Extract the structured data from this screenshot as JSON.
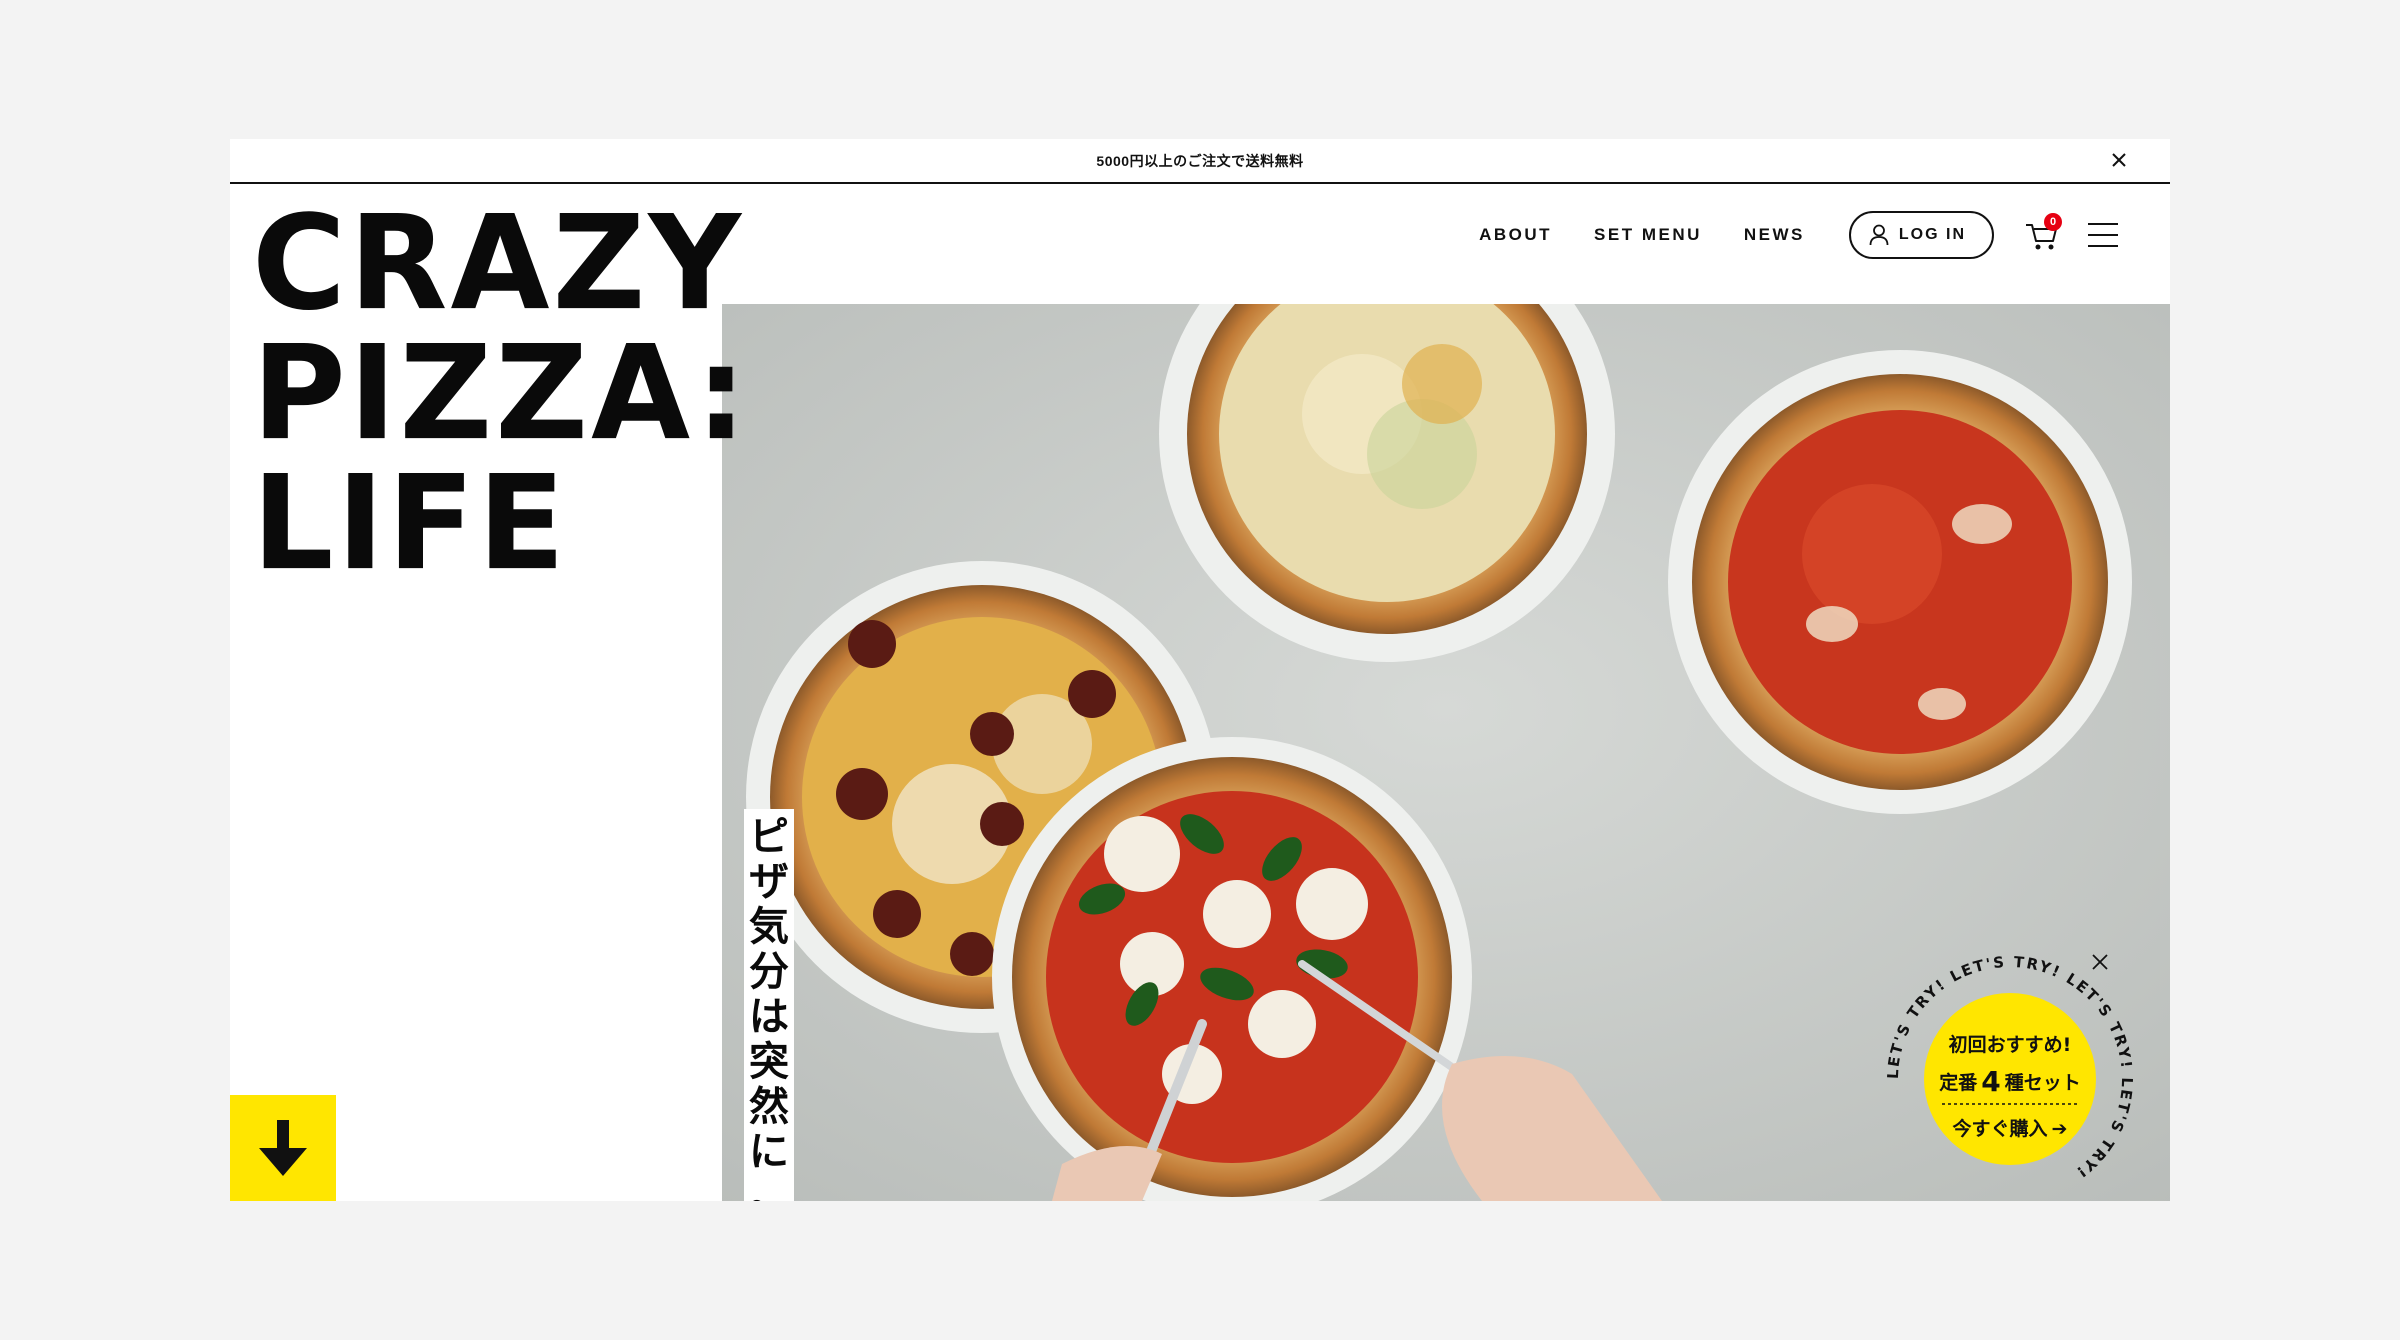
{
  "announcement": {
    "text": "5000円以上のご注文で送料無料"
  },
  "logo": {
    "lines": [
      "CRAZY",
      "PIZZA:",
      "LIFE"
    ]
  },
  "nav": {
    "items": [
      {
        "label": "ABOUT"
      },
      {
        "label": "SET MENU"
      },
      {
        "label": "NEWS"
      }
    ],
    "login_label": "LOG IN",
    "cart_count": "0"
  },
  "tagline": {
    "chars": [
      "ピ",
      "ザ",
      "気",
      "分",
      "は",
      "突",
      "然",
      "に",
      "。"
    ]
  },
  "promo": {
    "ring_text": "LET'S TRY! LET'S TRY! LET'S TRY! LET'S TRY! ",
    "line1": "初回おすすめ!",
    "line2_pre": "定番",
    "line2_num": "4",
    "line2_post": "種セット",
    "cta": "今すぐ購入",
    "cta_arrow": "➔"
  },
  "colors": {
    "accent": "#ffe600",
    "badge": "#e60012",
    "text": "#0a0a0a"
  },
  "icons": {
    "close": "close-icon",
    "user": "user-icon",
    "cart": "cart-icon",
    "menu": "hamburger-icon",
    "scroll": "arrow-down-icon"
  }
}
